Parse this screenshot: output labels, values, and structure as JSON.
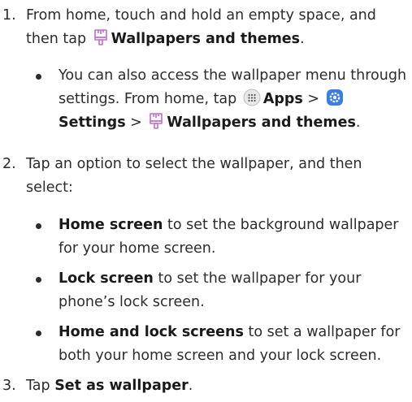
{
  "steps": [
    {
      "number": "1.",
      "intro": "From home, touch and hold an empty space, and then tap ",
      "target": "Wallpapers and themes",
      "end": ".",
      "note": {
        "text_a": "You can also access the wallpaper menu through settings. From home, tap ",
        "apps": "Apps",
        "sep": " > ",
        "settings": "Settings",
        "target": "Wallpapers and themes",
        "end": "."
      }
    },
    {
      "number": "2.",
      "text": "Tap an option to select the wallpaper, and then select:",
      "options": [
        {
          "label": "Home screen",
          "desc": " to set the background wallpaper for your home screen."
        },
        {
          "label": "Lock screen",
          "desc": " to set the wallpaper for your phone’s lock screen."
        },
        {
          "label": "Home and lock screens",
          "desc": " to set a wallpaper for both your home screen and your lock screen."
        }
      ]
    },
    {
      "number": "3.",
      "intro": "Tap ",
      "target": "Set as wallpaper",
      "end": "."
    }
  ],
  "icons": {
    "wallpaper_icon": "paint-brush-icon",
    "apps_icon": "apps-grid-icon",
    "settings_icon": "settings-gear-icon"
  },
  "colors": {
    "text": "#2c2c2c",
    "brush_icon": "#c070c8",
    "settings_bg": "#3a7fe0",
    "apps_bg": "#e8e8e8"
  }
}
